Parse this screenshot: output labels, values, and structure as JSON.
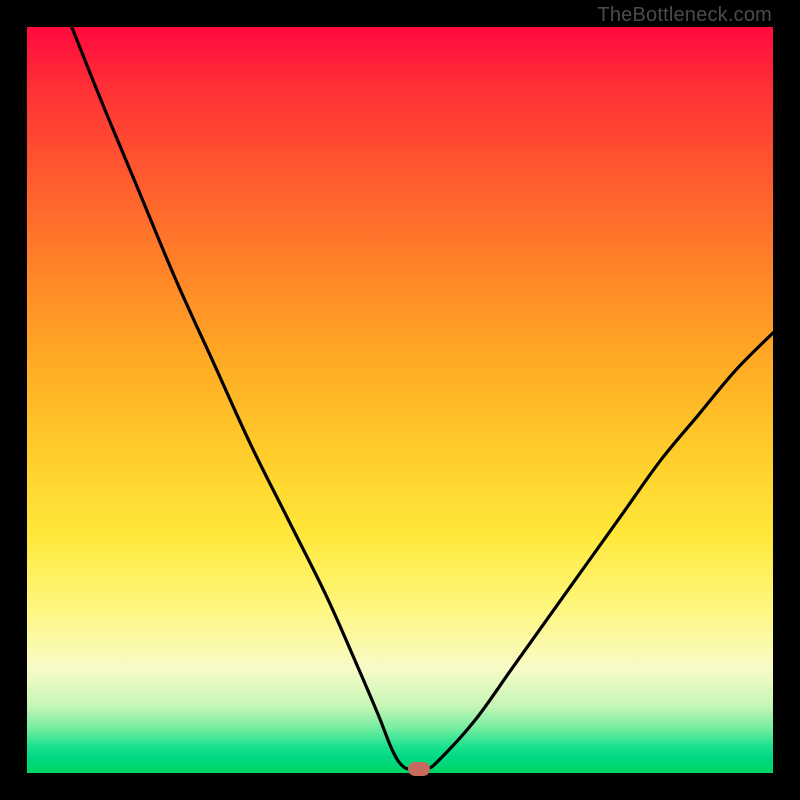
{
  "attribution": "TheBottleneck.com",
  "colors": {
    "curve_stroke": "#000000",
    "marker_fill": "#c46a5f"
  },
  "chart_data": {
    "type": "line",
    "title": "",
    "xlabel": "",
    "ylabel": "",
    "xlim": [
      0,
      100
    ],
    "ylim": [
      0,
      100
    ],
    "grid": false,
    "series": [
      {
        "name": "bottleneck-curve",
        "x": [
          6,
          10,
          15,
          20,
          25,
          30,
          35,
          40,
          44,
          47,
          49,
          50.5,
          52,
          53.5,
          55,
          60,
          65,
          70,
          75,
          80,
          85,
          90,
          95,
          100
        ],
        "y": [
          100,
          90,
          78,
          66,
          55,
          44,
          34,
          24,
          15,
          8,
          3,
          0.8,
          0.6,
          0.6,
          1.5,
          7,
          14,
          21,
          28,
          35,
          42,
          48,
          54,
          59
        ]
      }
    ],
    "marker": {
      "x": 52.5,
      "y": 0.6
    }
  }
}
